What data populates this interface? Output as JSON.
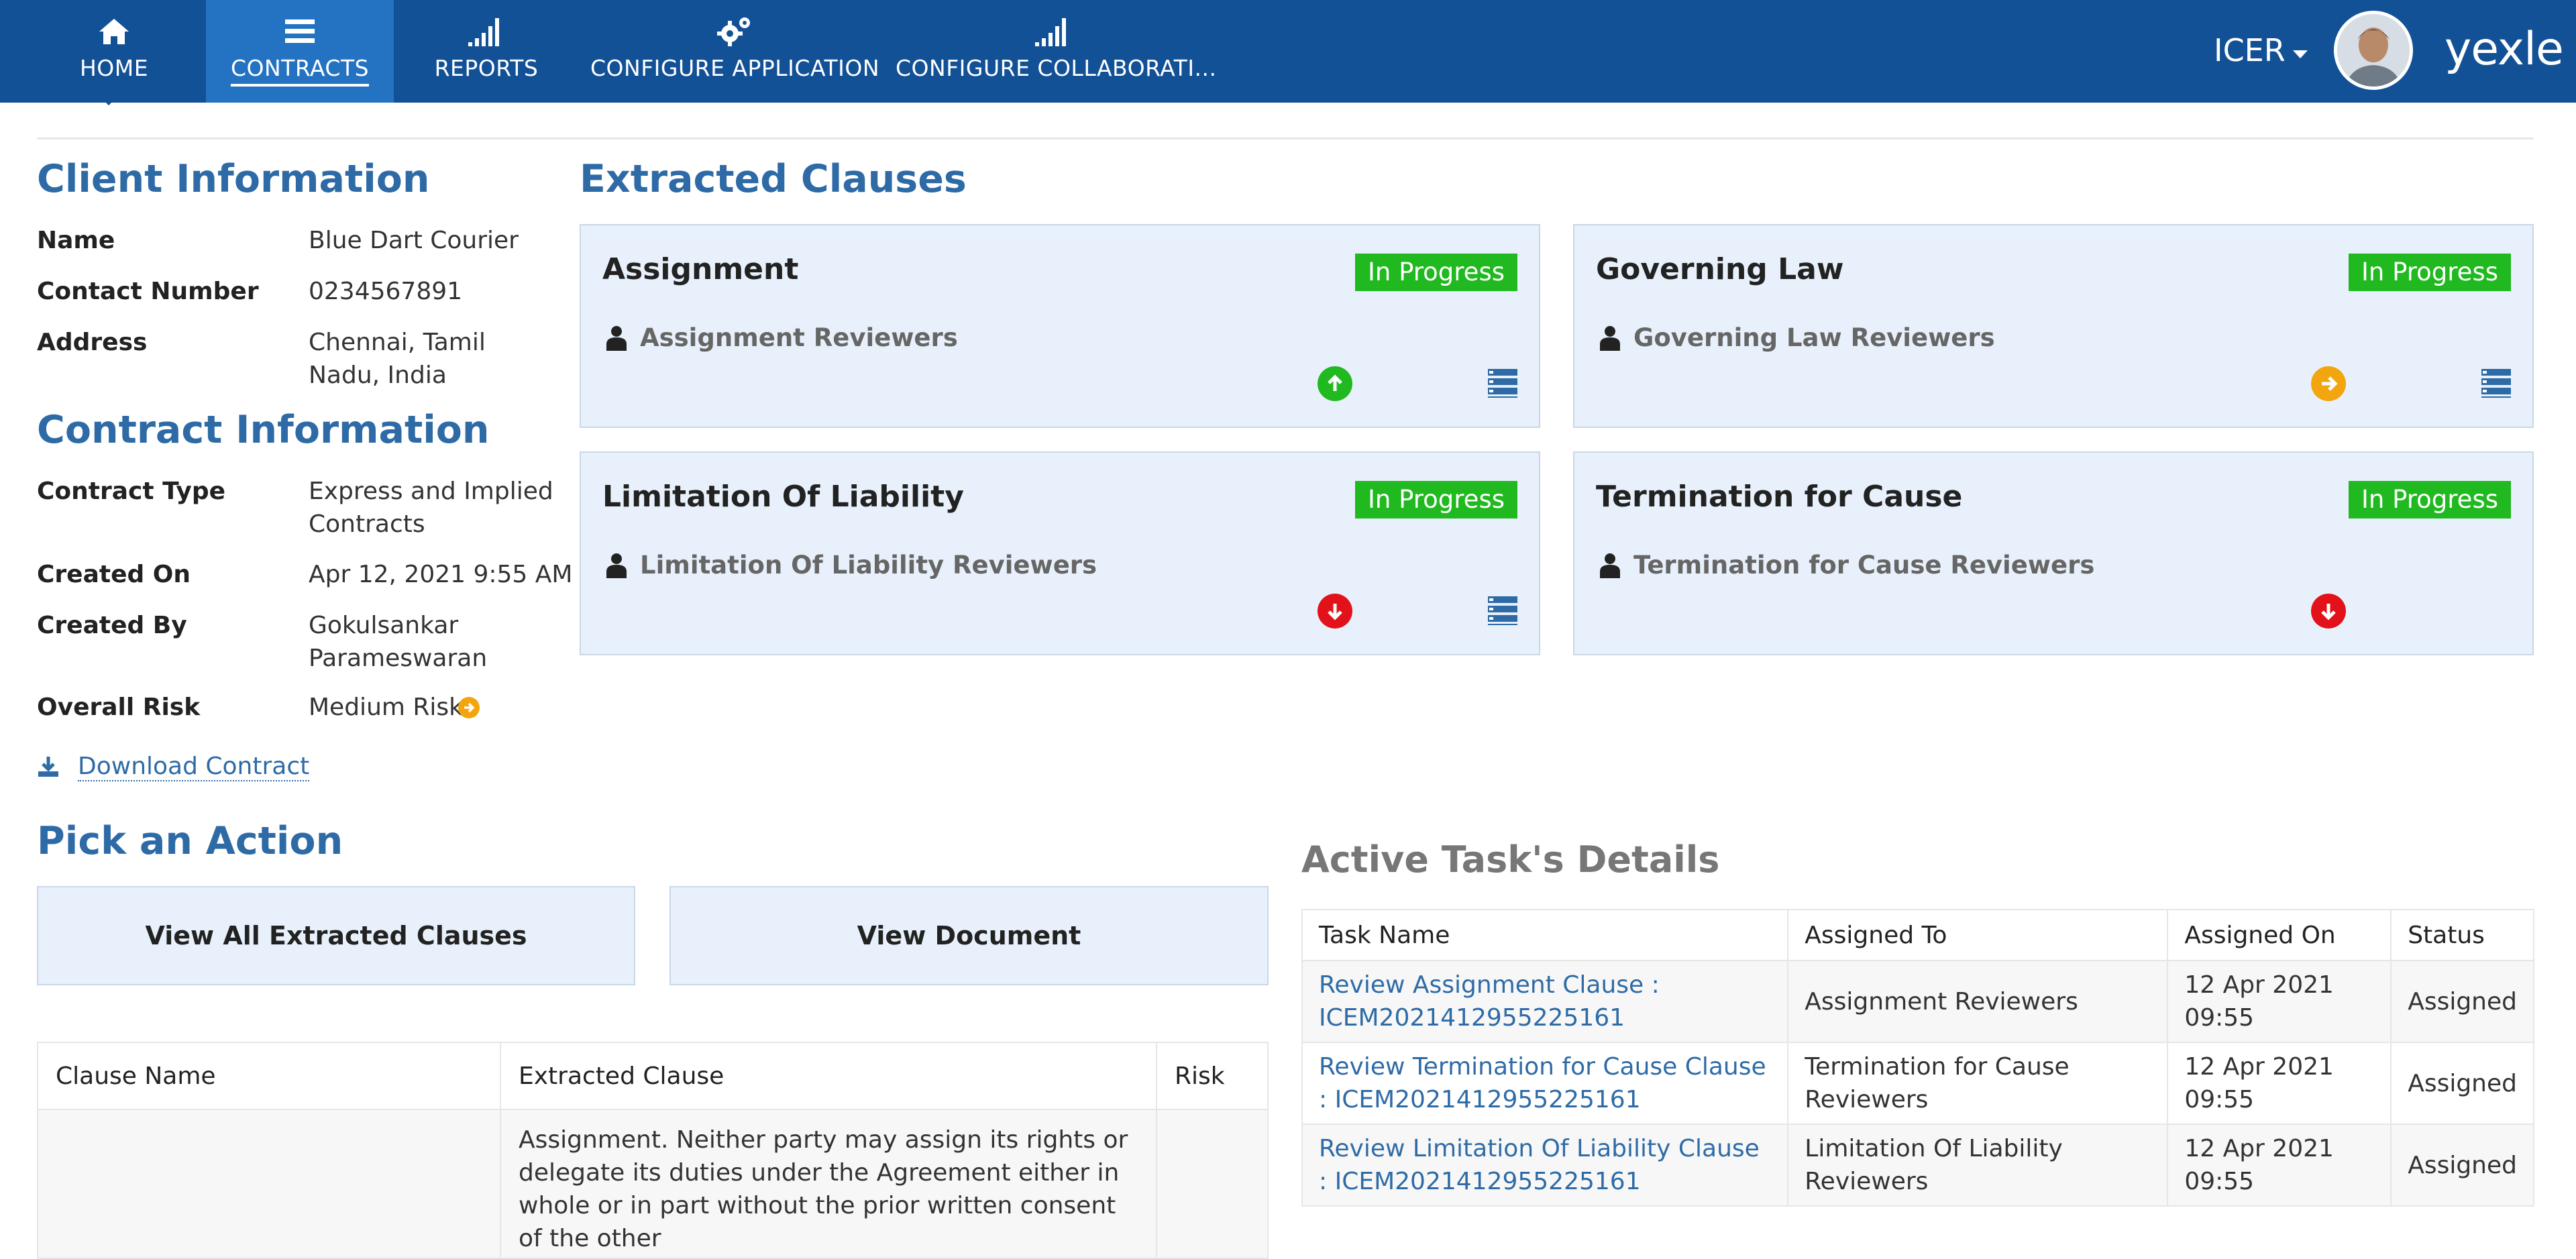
{
  "nav": {
    "items": [
      {
        "label": "HOME",
        "icon": "home-icon"
      },
      {
        "label": "CONTRACTS",
        "icon": "menu-icon"
      },
      {
        "label": "REPORTS",
        "icon": "signal-bars-icon"
      },
      {
        "label": "CONFIGURE APPLICATION",
        "icon": "gears-icon"
      },
      {
        "label": "CONFIGURE COLLABORATI...",
        "icon": "signal-bars-icon"
      }
    ],
    "active": "CONTRACTS",
    "user": "ICER",
    "brand": "yexle"
  },
  "colors": {
    "nav_bg": "#135197",
    "active_tab": "#2473c2",
    "heading": "#2e6ba6",
    "badge": "#20b91f",
    "risk_low": "#20b91f",
    "risk_medium": "#f2a50c",
    "risk_high": "#e3121a"
  },
  "client_info": {
    "title": "Client Information",
    "fields": [
      {
        "label": "Name",
        "value": "Blue Dart Courier"
      },
      {
        "label": "Contact Number",
        "value": "0234567891"
      },
      {
        "label": "Address",
        "value": "Chennai, Tamil Nadu, India"
      }
    ]
  },
  "contract_info": {
    "title": "Contract Information",
    "fields": [
      {
        "label": "Contract Type",
        "value": "Express and Implied Contracts"
      },
      {
        "label": "Created On",
        "value": "Apr 12, 2021 9:55 AM"
      },
      {
        "label": "Created By",
        "value": "Gokulsankar Parameswaran"
      },
      {
        "label": "Overall Risk",
        "value": "Medium Risk"
      }
    ],
    "download_label": "Download Contract"
  },
  "extracted_clauses": {
    "title": "Extracted Clauses",
    "cards": [
      {
        "title": "Assignment",
        "status": "In Progress",
        "reviewers": "Assignment Reviewers",
        "risk": "low"
      },
      {
        "title": "Governing Law",
        "status": "In Progress",
        "reviewers": "Governing Law Reviewers",
        "risk": "medium"
      },
      {
        "title": "Limitation Of Liability",
        "status": "In Progress",
        "reviewers": "Limitation Of Liability Reviewers",
        "risk": "high"
      },
      {
        "title": "Termination for Cause",
        "status": "In Progress",
        "reviewers": "Termination for Cause Reviewers",
        "risk": "high"
      }
    ]
  },
  "actions": {
    "title": "Pick an Action",
    "view_all": "View All Extracted Clauses",
    "view_doc": "View Document"
  },
  "clause_table": {
    "headers": [
      "Clause Name",
      "Extracted Clause",
      "Risk"
    ],
    "rows": [
      {
        "name": "",
        "clause": "Assignment. Neither party may assign its rights or delegate its duties under the Agreement either in whole or in part without the prior written consent of the other",
        "risk": ""
      }
    ]
  },
  "tasks": {
    "title": "Active Task's Details",
    "headers": [
      "Task Name",
      "Assigned To",
      "Assigned On",
      "Status"
    ],
    "rows": [
      {
        "name": "Review Assignment Clause : ICEM2021412955225161",
        "to": "Assignment Reviewers",
        "on": "12 Apr 2021 09:55",
        "status": "Assigned"
      },
      {
        "name": "Review Termination for Cause Clause : ICEM2021412955225161",
        "to": "Termination for Cause Reviewers",
        "on": "12 Apr 2021 09:55",
        "status": "Assigned"
      },
      {
        "name": "Review Limitation Of Liability Clause : ICEM2021412955225161",
        "to": "Limitation Of Liability Reviewers",
        "on": "12 Apr 2021 09:55",
        "status": "Assigned"
      }
    ]
  }
}
